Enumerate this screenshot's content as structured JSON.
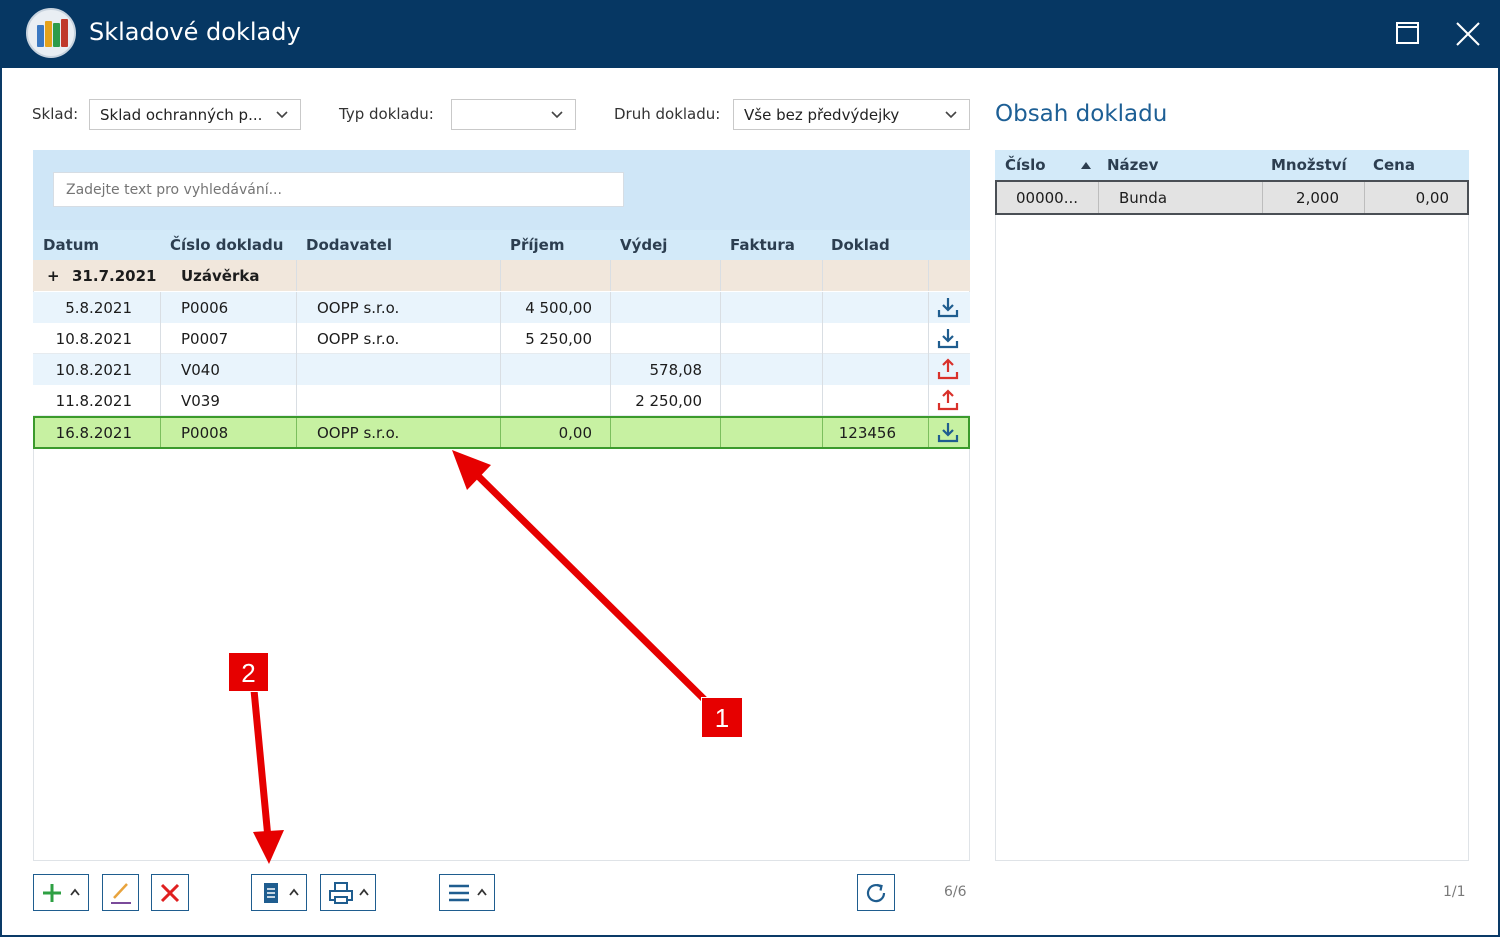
{
  "window": {
    "title": "Skladové doklady"
  },
  "filters": {
    "sklad_label": "Sklad:",
    "sklad_value": "Sklad ochranných p...",
    "typ_label": "Typ dokladu:",
    "typ_value": "",
    "druh_label": "Druh dokladu:",
    "druh_value": "Vše bez předvýdejky"
  },
  "search": {
    "placeholder": "Zadejte text pro vyhledávání..."
  },
  "grid": {
    "headers": {
      "datum": "Datum",
      "cislo": "Číslo dokladu",
      "dodavatel": "Dodavatel",
      "prijem": "Příjem",
      "vydej": "Výdej",
      "faktura": "Faktura",
      "doklad": "Doklad"
    },
    "group": {
      "toggle": "+",
      "date": "31.7.2021",
      "label": "Uzávěrka"
    },
    "rows": [
      {
        "datum": "5.8.2021",
        "cislo": "P0006",
        "dodavatel": "OOPP s.r.o.",
        "prijem": "4 500,00",
        "vydej": "",
        "faktura": "",
        "doklad": "",
        "icon": "download-icon"
      },
      {
        "datum": "10.8.2021",
        "cislo": "P0007",
        "dodavatel": "OOPP s.r.o.",
        "prijem": "5 250,00",
        "vydej": "",
        "faktura": "",
        "doklad": "",
        "icon": "download-icon"
      },
      {
        "datum": "10.8.2021",
        "cislo": "V040",
        "dodavatel": "",
        "prijem": "",
        "vydej": "578,08",
        "faktura": "",
        "doklad": "",
        "icon": "upload-icon"
      },
      {
        "datum": "11.8.2021",
        "cislo": "V039",
        "dodavatel": "",
        "prijem": "",
        "vydej": "2 250,00",
        "faktura": "",
        "doklad": "",
        "icon": "upload-icon"
      },
      {
        "datum": "16.8.2021",
        "cislo": "P0008",
        "dodavatel": "OOPP s.r.o.",
        "prijem": "0,00",
        "vydej": "",
        "faktura": "",
        "doklad": "123456",
        "icon": "download-icon"
      }
    ],
    "counter": "6/6"
  },
  "contents": {
    "title": "Obsah dokladu",
    "headers": {
      "cislo": "Číslo",
      "nazev": "Název",
      "mnozstvi": "Množství",
      "cena": "Cena"
    },
    "row": {
      "cislo": "00000...",
      "nazev": "Bunda",
      "mnozstvi": "2,000",
      "cena": "0,00"
    },
    "counter": "1/1"
  },
  "toolbar": {
    "buttons": [
      "add-icon",
      "edit-icon",
      "delete-icon",
      "document-icon",
      "print-icon",
      "menu-icon",
      "refresh-icon"
    ]
  },
  "annotations": {
    "one": "1",
    "two": "2"
  },
  "colors": {
    "titlebar": "#063763",
    "header_bg": "#d3eaf9",
    "selected_row": "#c7f1a2",
    "selected_border": "#3b9a2c",
    "download_icon": "#1f5d8f",
    "upload_icon": "#d9312b",
    "annotation": "#e60000"
  }
}
